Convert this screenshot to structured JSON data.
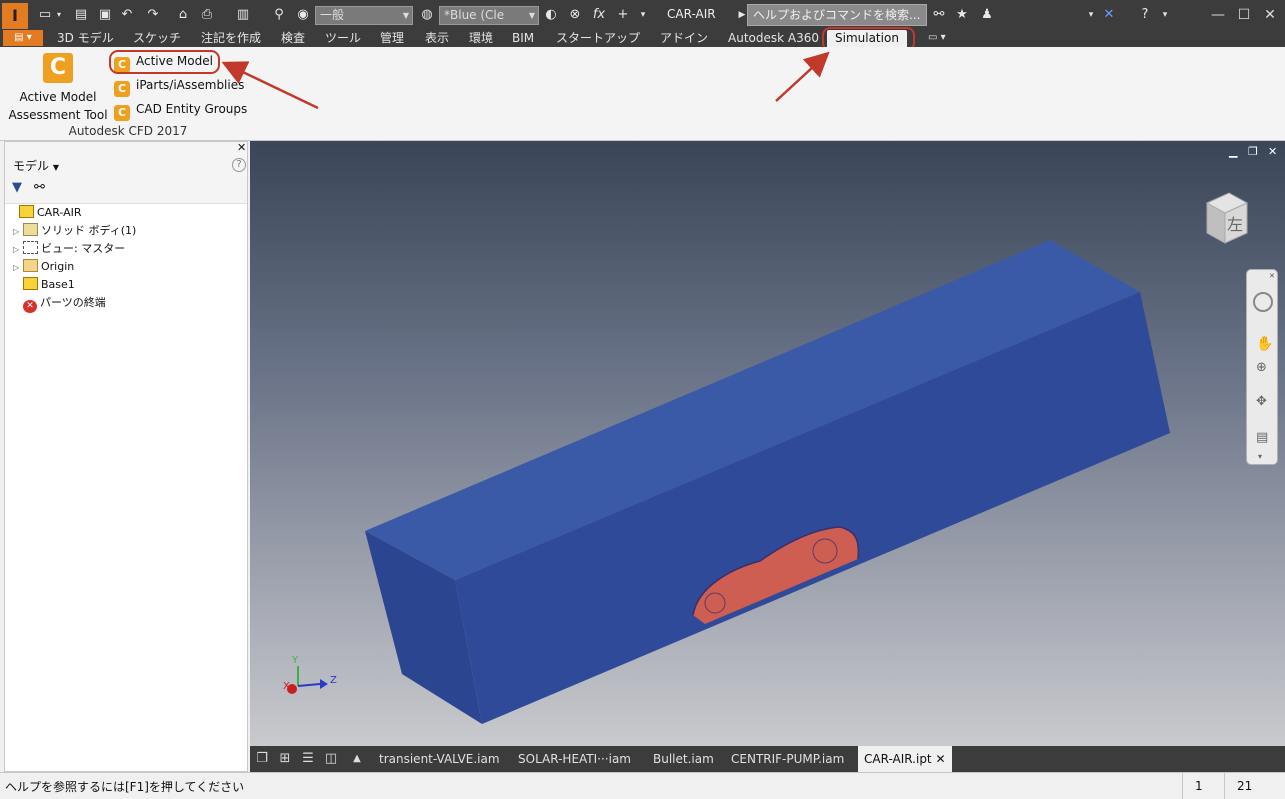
{
  "titlebar": {
    "logo": "I",
    "style_value": "一般",
    "appearance_value": "*Blue (Cle",
    "fx": "fx",
    "document_title": "CAR-AIR",
    "help_search_placeholder": "ヘルプおよびコマンドを検索..."
  },
  "tabs": [
    "3D モデル",
    "スケッチ",
    "注記を作成",
    "検査",
    "ツール",
    "管理",
    "表示",
    "環境",
    "BIM",
    "スタートアップ",
    "アドイン",
    "Autodesk A360",
    "Simulation"
  ],
  "active_tab": "Simulation",
  "ribbon": {
    "big_button_label_1": "Active Model",
    "big_button_label_2": "Assessment Tool",
    "items": [
      "Active Model",
      "iParts/iAssemblies",
      "CAD Entity Groups"
    ],
    "panel_title": "Autodesk CFD 2017"
  },
  "browser": {
    "title": "モデル",
    "help": "?",
    "close": "✕",
    "tree": [
      {
        "label": "CAR-AIR",
        "icon": "part-icon",
        "expand": false,
        "indent": 0
      },
      {
        "label": "ソリッド ボディ(1)",
        "icon": "solid-bodies-icon",
        "expand": true,
        "indent": 1
      },
      {
        "label": "ビュー: マスター",
        "icon": "view-icon",
        "expand": true,
        "indent": 1
      },
      {
        "label": "Origin",
        "icon": "folder-icon",
        "expand": true,
        "indent": 1
      },
      {
        "label": "Base1",
        "icon": "extrusion-icon",
        "expand": false,
        "indent": 1
      },
      {
        "label": "パーツの終端",
        "icon": "end-of-part-icon",
        "expand": false,
        "indent": 1
      }
    ]
  },
  "viewcube": {
    "face_label": "左"
  },
  "triad": {
    "x": "X",
    "y": "Y",
    "z": "Z"
  },
  "doctabs": [
    "transient-VALVE.iam",
    "SOLAR-HEATI···iam",
    "Bullet.iam",
    "CENTRIF-PUMP.iam",
    "CAR-AIR.ipt"
  ],
  "active_doc": "CAR-AIR.ipt",
  "status": {
    "help_text": "ヘルプを参照するには[F1]を押してください",
    "count1": "1",
    "count2": "21"
  },
  "colors": {
    "box_top": "#3a5aa8",
    "box_front": "#2f4a9c",
    "car": "#e0604a",
    "annotation": "#c0392b",
    "app_orange": "#e27b21"
  }
}
